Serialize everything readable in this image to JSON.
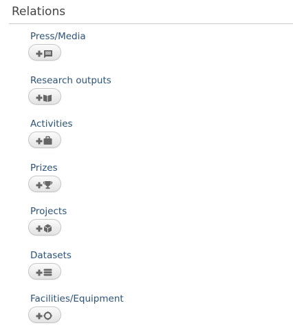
{
  "section": {
    "title": "Relations"
  },
  "relations": [
    {
      "label": "Press/Media",
      "icon": "press-media-icon"
    },
    {
      "label": "Research outputs",
      "icon": "book-icon"
    },
    {
      "label": "Activities",
      "icon": "briefcase-icon"
    },
    {
      "label": "Prizes",
      "icon": "trophy-icon"
    },
    {
      "label": "Projects",
      "icon": "cube-icon"
    },
    {
      "label": "Datasets",
      "icon": "database-icon"
    },
    {
      "label": "Facilities/Equipment",
      "icon": "ring-icon"
    }
  ],
  "colors": {
    "label": "#2b5278",
    "title": "#444444",
    "icon": "#666666",
    "button_border": "#c6c6c6"
  }
}
